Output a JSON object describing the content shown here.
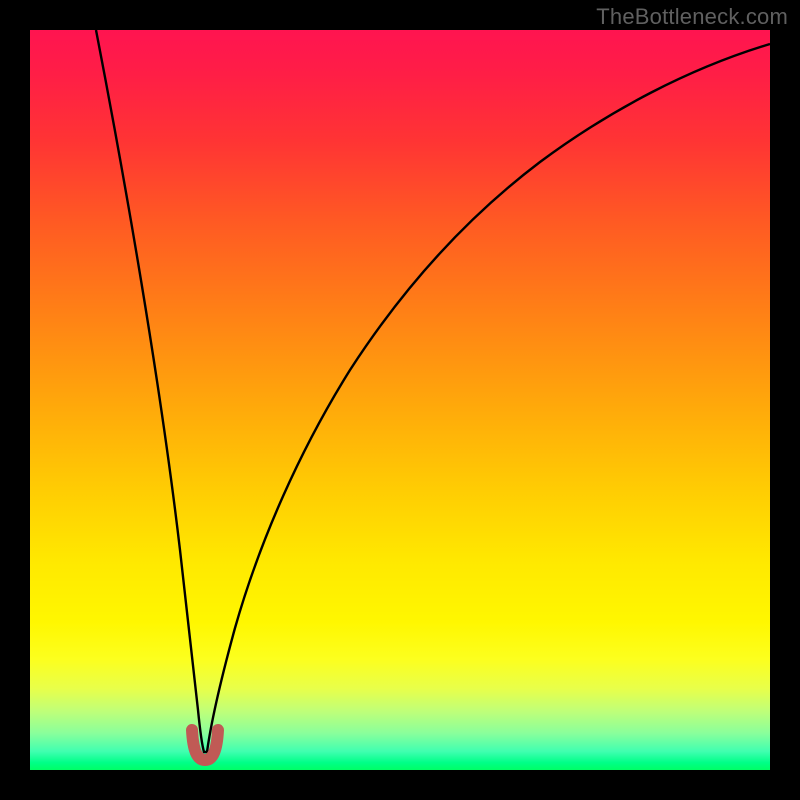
{
  "watermark": "TheBottleneck.com",
  "chart_data": {
    "type": "line",
    "title": "",
    "xlabel": "",
    "ylabel": "",
    "xlim": [
      0,
      100
    ],
    "ylim": [
      0,
      100
    ],
    "grid": false,
    "note": "No axis ticks or numeric labels are shown in the image; x and y units are unlabeled. Values are estimated from pixel positions on a 0–100 normalized scale.",
    "series": [
      {
        "name": "curve",
        "x": [
          9,
          12,
          15,
          18,
          20,
          21.5,
          22.5,
          23.5,
          24.5,
          26,
          28,
          32,
          38,
          46,
          56,
          68,
          80,
          92,
          100
        ],
        "values": [
          100,
          82,
          62,
          40,
          20,
          8,
          2.5,
          2,
          2.5,
          8,
          22,
          42,
          58,
          70,
          79,
          86,
          91,
          95,
          97
        ]
      },
      {
        "name": "minimum-marker",
        "x": [
          22.2,
          22.6,
          23,
          23.4,
          23.8,
          24.2,
          24.6
        ],
        "values": [
          5.5,
          3.0,
          2.0,
          1.8,
          2.0,
          3.0,
          5.5
        ]
      }
    ],
    "colors": {
      "curve": "#000000",
      "minimum_marker": "#c05a55",
      "gradient_top": "#ff1450",
      "gradient_mid": "#ffe900",
      "gradient_bottom": "#00ff66",
      "frame": "#000000"
    }
  }
}
